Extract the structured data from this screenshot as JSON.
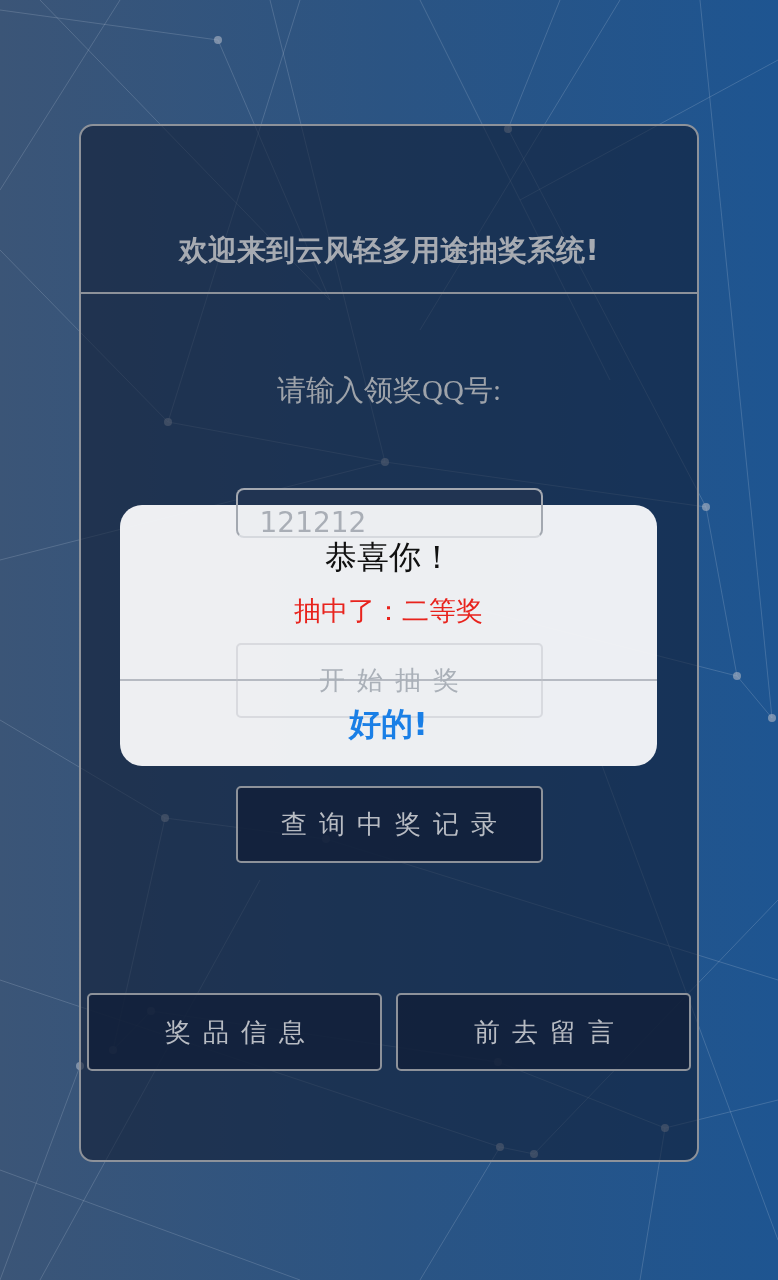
{
  "header": {
    "title": "欢迎来到云风轻多用途抽奖系统!"
  },
  "form": {
    "label": "请输入领奖QQ号:",
    "qq_input": {
      "value": "121212"
    },
    "buttons": [
      {
        "label": "开始抽奖"
      },
      {
        "label": "查询中奖记录"
      }
    ]
  },
  "footer_buttons": [
    {
      "label": "奖品信息"
    },
    {
      "label": "前去留言"
    }
  ],
  "dialog": {
    "title": "恭喜你！",
    "message": "抽中了：二等奖",
    "confirm_button": "好的!"
  }
}
